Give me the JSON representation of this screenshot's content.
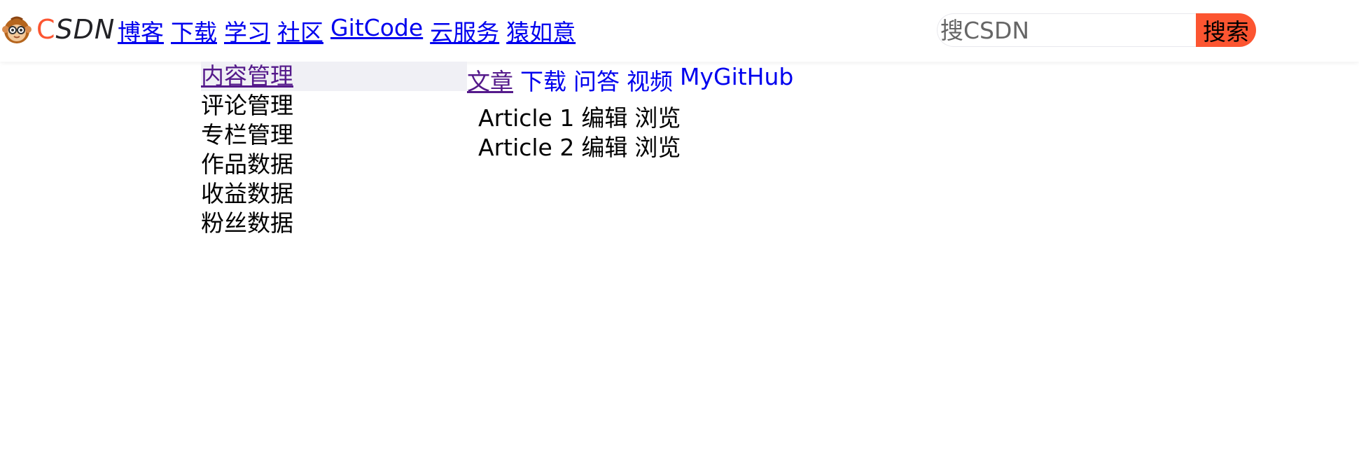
{
  "header": {
    "logo": {
      "icon": "csdn-monkey-logo",
      "text_c": "C",
      "text_rest": "SDN",
      "brand_color": "#fc5531"
    },
    "nav": [
      "博客",
      "下载",
      "学习",
      "社区",
      "GitCode",
      "云服务",
      "猿如意"
    ],
    "search": {
      "placeholder": "搜CSDN",
      "value": "",
      "button_label": "搜索"
    }
  },
  "sidebar": {
    "items": [
      {
        "label": "内容管理",
        "active": true
      },
      {
        "label": "评论管理",
        "active": false
      },
      {
        "label": "专栏管理",
        "active": false
      },
      {
        "label": "作品数据",
        "active": false
      },
      {
        "label": "收益数据",
        "active": false
      },
      {
        "label": "粉丝数据",
        "active": false
      }
    ]
  },
  "content": {
    "tabs": [
      {
        "label": "文章",
        "active": true
      },
      {
        "label": "下载",
        "active": false
      },
      {
        "label": "问答",
        "active": false
      },
      {
        "label": "视频",
        "active": false
      },
      {
        "label": "MyGitHub",
        "active": false
      }
    ],
    "articles": [
      {
        "title": "Article 1",
        "edit": "编辑",
        "view": "浏览"
      },
      {
        "title": "Article 2",
        "edit": "编辑",
        "view": "浏览"
      }
    ]
  },
  "colors": {
    "link": "#0000ee",
    "visited_link": "#551a8b",
    "accent": "#fc5531",
    "active_bg": "#f0f0f5"
  }
}
